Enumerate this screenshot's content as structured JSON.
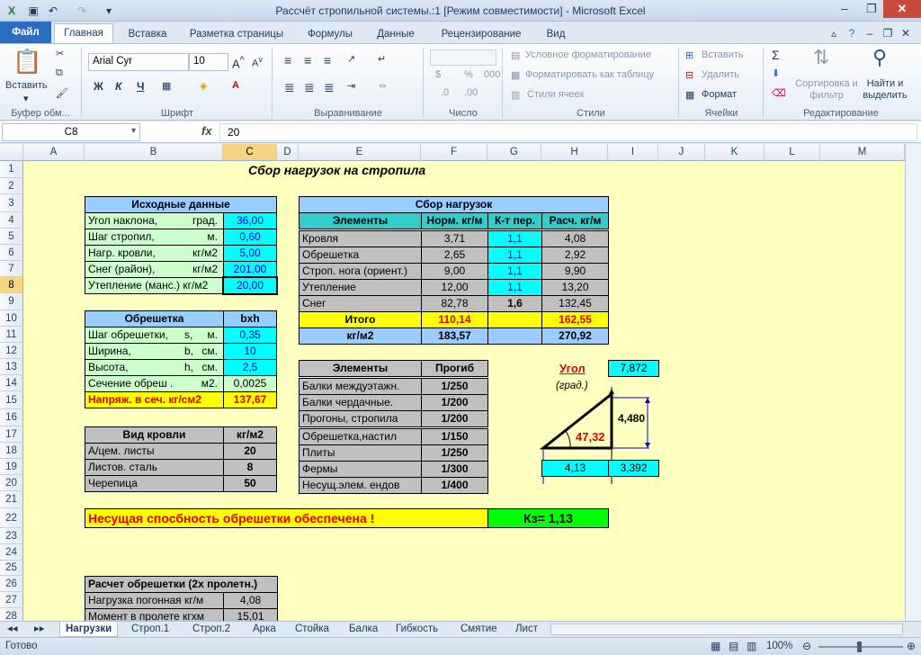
{
  "window": {
    "title": "Рассчёт стропильной системы.:1  [Режим совместимости]  -  Microsoft Excel"
  },
  "ribbon_tabs": [
    "Файл",
    "Главная",
    "Вставка",
    "Разметка страницы",
    "Формулы",
    "Данные",
    "Рецензирование",
    "Вид"
  ],
  "ribbon": {
    "paste": "Вставить",
    "font_name": "Arial Cyr",
    "font_size": "10",
    "bold": "Ж",
    "italic": "К",
    "underline": "Ч",
    "number_format": "%",
    "cond_format": "Условное форматирование",
    "format_table": "Форматировать как таблицу",
    "cell_styles": "Стили ячеек",
    "insert": "Вставить",
    "delete": "Удалить",
    "format": "Формат",
    "sort": "Сортировка и фильтр",
    "find": "Найти и выделить",
    "groups": [
      "Буфер обм...",
      "Шрифт",
      "Выравнивание",
      "Число",
      "Стили",
      "Ячейки",
      "Редактирование"
    ]
  },
  "formula_bar": {
    "name_box": "C8",
    "fx": "fx",
    "value": "20"
  },
  "columns": [
    "A",
    "B",
    "C",
    "D",
    "E",
    "F",
    "G",
    "H",
    "I",
    "J",
    "K",
    "L",
    "M"
  ],
  "rows": [
    "1",
    "2",
    "3",
    "4",
    "5",
    "6",
    "7",
    "8",
    "9",
    "10",
    "11",
    "12",
    "13",
    "14",
    "15",
    "16",
    "17",
    "18",
    "19",
    "20",
    "21",
    "22",
    "23",
    "24",
    "25",
    "26",
    "27",
    "28"
  ],
  "sheet": {
    "title": "Сбор нагрузок на стропила",
    "input": {
      "header": "Исходные данные",
      "rows": [
        {
          "label": "Угол наклона,",
          "unit": "град.",
          "value": "36,00"
        },
        {
          "label": "Шаг стропил,",
          "unit": "м.",
          "value": "0,60"
        },
        {
          "label": "Нагр. кровли,",
          "unit": "кг/м2",
          "value": "5,00"
        },
        {
          "label": "Снег (район),",
          "unit": "кг/м2",
          "value": "201,00"
        },
        {
          "label": "Утепление (манс.) кг/м2",
          "unit": "",
          "value": "20,00"
        }
      ]
    },
    "batten": {
      "header": "Обрешетка",
      "header2": "bxh",
      "rows": [
        {
          "label": "Шаг обрешетки,",
          "sym": "s,",
          "unit": "м.",
          "value": "0,35"
        },
        {
          "label": "Ширина,",
          "sym": "b,",
          "unit": "см.",
          "value": "10"
        },
        {
          "label": "Высота,",
          "sym": "h,",
          "unit": "см.",
          "value": "2,5"
        },
        {
          "label": "Сечение обреш .",
          "sym": "",
          "unit": "м2.",
          "value": "0,0025"
        }
      ],
      "stress_label": "Напряж. в сеч.  кг/см2",
      "stress_value": "137,67"
    },
    "roof": {
      "header": "Вид кровли",
      "header2": "кг/м2",
      "rows": [
        {
          "label": "А/цем. листы",
          "value": "20"
        },
        {
          "label": "Листов. сталь",
          "value": "8"
        },
        {
          "label": "Черепица",
          "value": "50"
        }
      ]
    },
    "loads": {
      "header": "Сбор нагрузок",
      "cols": [
        "Элементы",
        "Норм. кг/м",
        "К-т пер.",
        "Расч. кг/м"
      ],
      "rows": [
        {
          "name": "Кровля",
          "norm": "3,71",
          "k": "1,1",
          "calc": "4,08"
        },
        {
          "name": "Обрешетка",
          "norm": "2,65",
          "k": "1,1",
          "calc": "2,92"
        },
        {
          "name": "Строп. нога (ориент.)",
          "norm": "9,00",
          "k": "1,1",
          "calc": "9,90"
        },
        {
          "name": "Утепление",
          "norm": "12,00",
          "k": "1,1",
          "calc": "13,20"
        },
        {
          "name": "Снег",
          "norm": "82,78",
          "k": "1,6",
          "calc": "132,45"
        }
      ],
      "total_label": "Итого",
      "total_norm": "110,14",
      "total_calc": "162,55",
      "perm_label": "кг/м2",
      "perm_norm": "183,57",
      "perm_calc": "270,92"
    },
    "deflection": {
      "cols": [
        "Элементы",
        "Прогиб"
      ],
      "rows": [
        {
          "name": "Балки междуэтажн.",
          "val": "1/250"
        },
        {
          "name": "Балки чердачные.",
          "val": "1/200"
        },
        {
          "name": "Прогоны, стропила",
          "val": "1/200"
        },
        {
          "name": "Обрешетка,настил",
          "val": "1/150"
        },
        {
          "name": "Плиты",
          "val": "1/250"
        },
        {
          "name": "Фермы",
          "val": "1/300"
        },
        {
          "name": "Несущ.элем. ендов",
          "val": "1/400"
        }
      ]
    },
    "diagram": {
      "angle_label": "Угол",
      "angle_unit": "(град.)",
      "angle_value": "7,872",
      "height": "4,480",
      "inner_angle": "47,32",
      "base": "4,13",
      "run": "3,392"
    },
    "capacity": {
      "text": "Несущая спосбность обрешетки   обеспечена !",
      "kz": "Кз=  1,13"
    },
    "calc": {
      "header": "Расчет обрешетки (2х пролетн.)",
      "rows": [
        {
          "label": "Нагрузка погонная кг/м",
          "value": "4,08"
        },
        {
          "label": "Момент в пролете  кгхм",
          "value": "15,01"
        }
      ]
    }
  },
  "sheet_tabs": [
    "Нагрузки",
    "Строп.1",
    "Строп.2",
    "Арка",
    "Стойка",
    "Балка",
    "Гибкость",
    "Смятие",
    "Лист"
  ],
  "status": {
    "ready": "Готово",
    "zoom": "100%"
  }
}
